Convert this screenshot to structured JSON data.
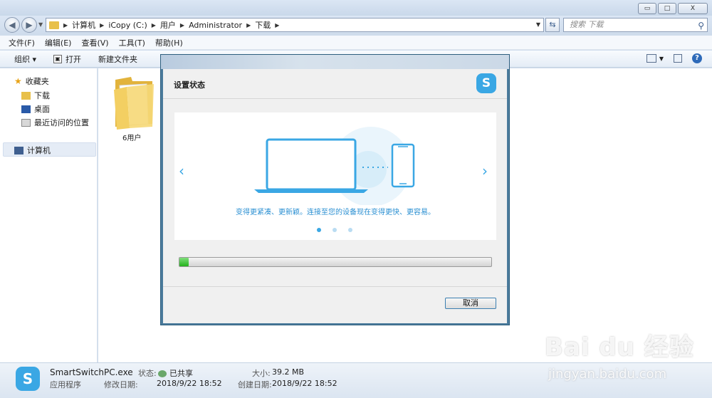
{
  "window": {
    "minimize": "▭",
    "maximize": "□",
    "close": "X"
  },
  "address": {
    "crumbs": [
      "计算机",
      "iCopy (C:)",
      "用户",
      "Administrator",
      "下载"
    ],
    "search_placeholder": "搜索 下载"
  },
  "menu": [
    "文件(F)",
    "编辑(E)",
    "查看(V)",
    "工具(T)",
    "帮助(H)"
  ],
  "toolbar": {
    "organize": "组织 ▾",
    "open": "打开",
    "new_folder": "新建文件夹"
  },
  "nav": {
    "favorites": "收藏夹",
    "downloads": "下载",
    "desktop": "桌面",
    "recent": "最近访问的位置",
    "computer": "计算机"
  },
  "content": {
    "folder_name": "6用户"
  },
  "dialog": {
    "heading": "设置状态",
    "logo_glyph": "S",
    "slide_text": "变得更紧凑、更新颖。连接至您的设备现在变得更快、更容易。",
    "progress": 0.03,
    "cancel_label": "取消",
    "accent": "#3aa7e4"
  },
  "status": {
    "filename": "SmartSwitchPC.exe",
    "filetype": "应用程序",
    "state_label": "状态:",
    "state_value": "已共享",
    "modified_label": "修改日期:",
    "modified_value": "2018/9/22 18:52",
    "size_label": "大小:",
    "size_value": "39.2 MB",
    "created_label": "创建日期:",
    "created_value": "2018/9/22 18:52"
  },
  "watermark": {
    "brand": "Bai du 经验",
    "url": "jingyan.baidu.com"
  }
}
